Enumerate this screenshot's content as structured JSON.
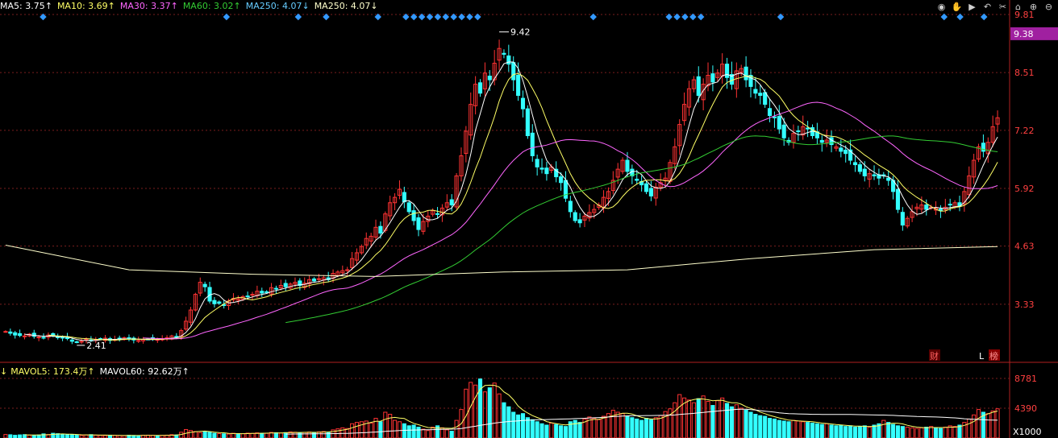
{
  "legend": {
    "items": [
      {
        "label": "MA5: 3.75",
        "arrow": "↑",
        "color": "#ffffff"
      },
      {
        "label": "MA10: 3.69",
        "arrow": "↑",
        "color": "#ffff66"
      },
      {
        "label": "MA30: 3.37",
        "arrow": "↑",
        "color": "#ff66ff"
      },
      {
        "label": "MA60: 3.02",
        "arrow": "↑",
        "color": "#33cc33"
      },
      {
        "label": "MA250: 4.07",
        "arrow": "↓",
        "color": "#66ccff"
      },
      {
        "label": "MA250: 4.07",
        "arrow": "↓",
        "color": "#ffffcc"
      }
    ]
  },
  "volume_legend": {
    "prefix": "↓",
    "items": [
      {
        "label": "MAVOL5: 173.4万",
        "arrow": "↑",
        "color": "#ffff66"
      },
      {
        "label": "MAVOL60: 92.62万",
        "arrow": "↑",
        "color": "#ffffff"
      }
    ]
  },
  "toolbar": {
    "icons": [
      {
        "name": "eye-icon",
        "glyph": "◉"
      },
      {
        "name": "hand-icon",
        "glyph": "✋"
      },
      {
        "name": "play-icon",
        "glyph": "▶"
      },
      {
        "name": "undo-icon",
        "glyph": "↶"
      },
      {
        "name": "scissors-icon",
        "glyph": "✂"
      },
      {
        "name": "lock-icon",
        "glyph": "⌂"
      },
      {
        "name": "zoom-in-icon",
        "glyph": "⊕"
      },
      {
        "name": "zoom-out-icon",
        "glyph": "⊖"
      }
    ]
  },
  "markers": {
    "finance_label": "财",
    "l_label": "L",
    "rank_label": "榜",
    "high_label": "9.42",
    "low_label": "2.41",
    "current_price": "9.38",
    "volume_unit": "X1000"
  },
  "colors": {
    "up": "#ff3333",
    "down": "#33ffff",
    "background": "#000000",
    "grid": "#7a1e1e",
    "axis_text": "#ff4040",
    "price_tag_bg": "#a020a0",
    "marker": "#3399ff"
  },
  "chart_data": {
    "type": "candlestick",
    "price_axis": {
      "ticks": [
        9.81,
        8.51,
        7.22,
        5.92,
        4.63,
        3.33
      ],
      "ylim": [
        2.03,
        9.81
      ]
    },
    "volume_axis": {
      "ticks": [
        8781,
        4390
      ],
      "ylim": [
        0,
        8781
      ],
      "unit": "X1000"
    },
    "high": {
      "value": 9.42,
      "label": "9.42"
    },
    "low": {
      "value": 2.41,
      "label": "2.41"
    },
    "current_price": 9.38,
    "close": [
      2.72,
      2.68,
      2.64,
      2.63,
      2.62,
      2.66,
      2.61,
      2.6,
      2.58,
      2.64,
      2.62,
      2.59,
      2.58,
      2.56,
      2.5,
      2.48,
      2.5,
      2.55,
      2.52,
      2.54,
      2.55,
      2.57,
      2.52,
      2.54,
      2.56,
      2.58,
      2.55,
      2.53,
      2.52,
      2.54,
      2.55,
      2.56,
      2.54,
      2.55,
      2.58,
      2.62,
      2.6,
      2.74,
      2.95,
      3.2,
      3.55,
      3.82,
      3.72,
      3.4,
      3.34,
      3.35,
      3.3,
      3.4,
      3.46,
      3.45,
      3.5,
      3.5,
      3.55,
      3.62,
      3.58,
      3.6,
      3.7,
      3.68,
      3.75,
      3.72,
      3.78,
      3.82,
      3.75,
      3.8,
      3.88,
      3.85,
      3.9,
      3.92,
      3.88,
      4.02,
      4.05,
      4.08,
      4.1,
      4.35,
      4.48,
      4.62,
      4.8,
      4.85,
      5.05,
      4.92,
      5.35,
      5.6,
      5.72,
      5.9,
      5.62,
      5.4,
      5.2,
      5.0,
      5.18,
      5.3,
      5.42,
      5.35,
      5.48,
      5.6,
      5.55,
      6.2,
      6.65,
      7.2,
      7.8,
      8.25,
      8.05,
      8.5,
      8.35,
      8.72,
      9.05,
      8.92,
      8.7,
      8.35,
      8.0,
      7.7,
      7.1,
      6.65,
      6.4,
      6.35,
      6.25,
      6.4,
      6.18,
      6.05,
      5.7,
      5.4,
      5.2,
      5.15,
      5.3,
      5.38,
      5.45,
      5.55,
      5.72,
      5.85,
      6.1,
      6.35,
      6.55,
      6.3,
      6.2,
      6.1,
      6.0,
      5.85,
      5.75,
      5.95,
      6.05,
      6.15,
      6.5,
      6.85,
      7.35,
      7.8,
      8.15,
      8.35,
      8.0,
      8.25,
      8.45,
      8.3,
      8.5,
      8.7,
      8.4,
      8.25,
      8.55,
      8.6,
      8.35,
      8.2,
      8.05,
      8.0,
      7.8,
      7.55,
      7.5,
      7.25,
      7.05,
      6.95,
      7.15,
      7.2,
      7.3,
      7.25,
      7.1,
      7.05,
      6.95,
      7.0,
      6.9,
      6.85,
      6.75,
      6.7,
      6.55,
      6.45,
      6.3,
      6.2,
      6.25,
      6.2,
      6.15,
      6.2,
      6.1,
      5.85,
      5.45,
      5.1,
      5.25,
      5.4,
      5.5,
      5.55,
      5.45,
      5.5,
      5.48,
      5.42,
      5.5,
      5.55,
      5.6,
      5.52,
      5.85,
      6.2,
      6.55,
      6.85,
      6.75,
      6.95,
      7.3,
      7.5
    ],
    "series": [
      {
        "name": "MA5",
        "color": "#ffffff",
        "window": 5
      },
      {
        "name": "MA10",
        "color": "#ffff66",
        "window": 10
      },
      {
        "name": "MA30",
        "color": "#ff66ff",
        "window": 30
      },
      {
        "name": "MA60",
        "color": "#33cc33",
        "window": 60
      },
      {
        "name": "MA250",
        "color": "#ffffcc",
        "values": [
          4.65,
          4.1,
          4.0,
          3.95,
          4.05,
          4.1,
          4.35,
          4.55,
          4.62
        ]
      }
    ],
    "volume": [
      520,
      480,
      410,
      460,
      500,
      430,
      390,
      450,
      610,
      520,
      700,
      640,
      530,
      480,
      520,
      470,
      380,
      450,
      500,
      420,
      380,
      360,
      420,
      390,
      350,
      330,
      410,
      380,
      360,
      400,
      420,
      390,
      350,
      380,
      420,
      500,
      460,
      850,
      1250,
      1100,
      950,
      800,
      1000,
      880,
      700,
      650,
      620,
      580,
      700,
      650,
      640,
      720,
      680,
      760,
      700,
      690,
      820,
      780,
      740,
      800,
      900,
      850,
      780,
      820,
      880,
      840,
      900,
      950,
      870,
      1200,
      1350,
      1500,
      1400,
      2100,
      2300,
      2400,
      2500,
      2200,
      2900,
      2400,
      3800,
      3500,
      2600,
      2400,
      2100,
      1800,
      1900,
      1600,
      1300,
      1100,
      1600,
      1800,
      1500,
      1200,
      1000,
      2600,
      4200,
      7200,
      8200,
      7800,
      8700,
      6800,
      7400,
      8100,
      6500,
      5200,
      4600,
      3800,
      3400,
      3600,
      3000,
      2700,
      2400,
      2100,
      1900,
      2200,
      2000,
      1800,
      1700,
      2400,
      2600,
      2300,
      2800,
      3100,
      2900,
      2700,
      3200,
      3600,
      4100,
      3800,
      3600,
      3200,
      3000,
      2800,
      2600,
      2900,
      2700,
      3000,
      3300,
      3900,
      4300,
      5200,
      6400,
      5900,
      5600,
      5200,
      5800,
      6200,
      5400,
      4800,
      5500,
      5900,
      5100,
      4600,
      4900,
      4400,
      4100,
      3800,
      3500,
      3300,
      3200,
      2900,
      2800,
      2600,
      2500,
      2400,
      2600,
      2500,
      2400,
      2300,
      2200,
      2100,
      2000,
      2100,
      1900,
      1800,
      1900,
      1700,
      1800,
      1600,
      1700,
      1800,
      1600,
      1900,
      2100,
      2600,
      2300,
      2000,
      1800,
      1700,
      1600,
      1500,
      1400,
      1500,
      1600,
      1700,
      1500,
      1400,
      1600,
      1800,
      1700,
      1900,
      2300,
      2800,
      3400,
      4200,
      3800,
      3600,
      4000,
      4300
    ],
    "dots_up_to": 236
  }
}
